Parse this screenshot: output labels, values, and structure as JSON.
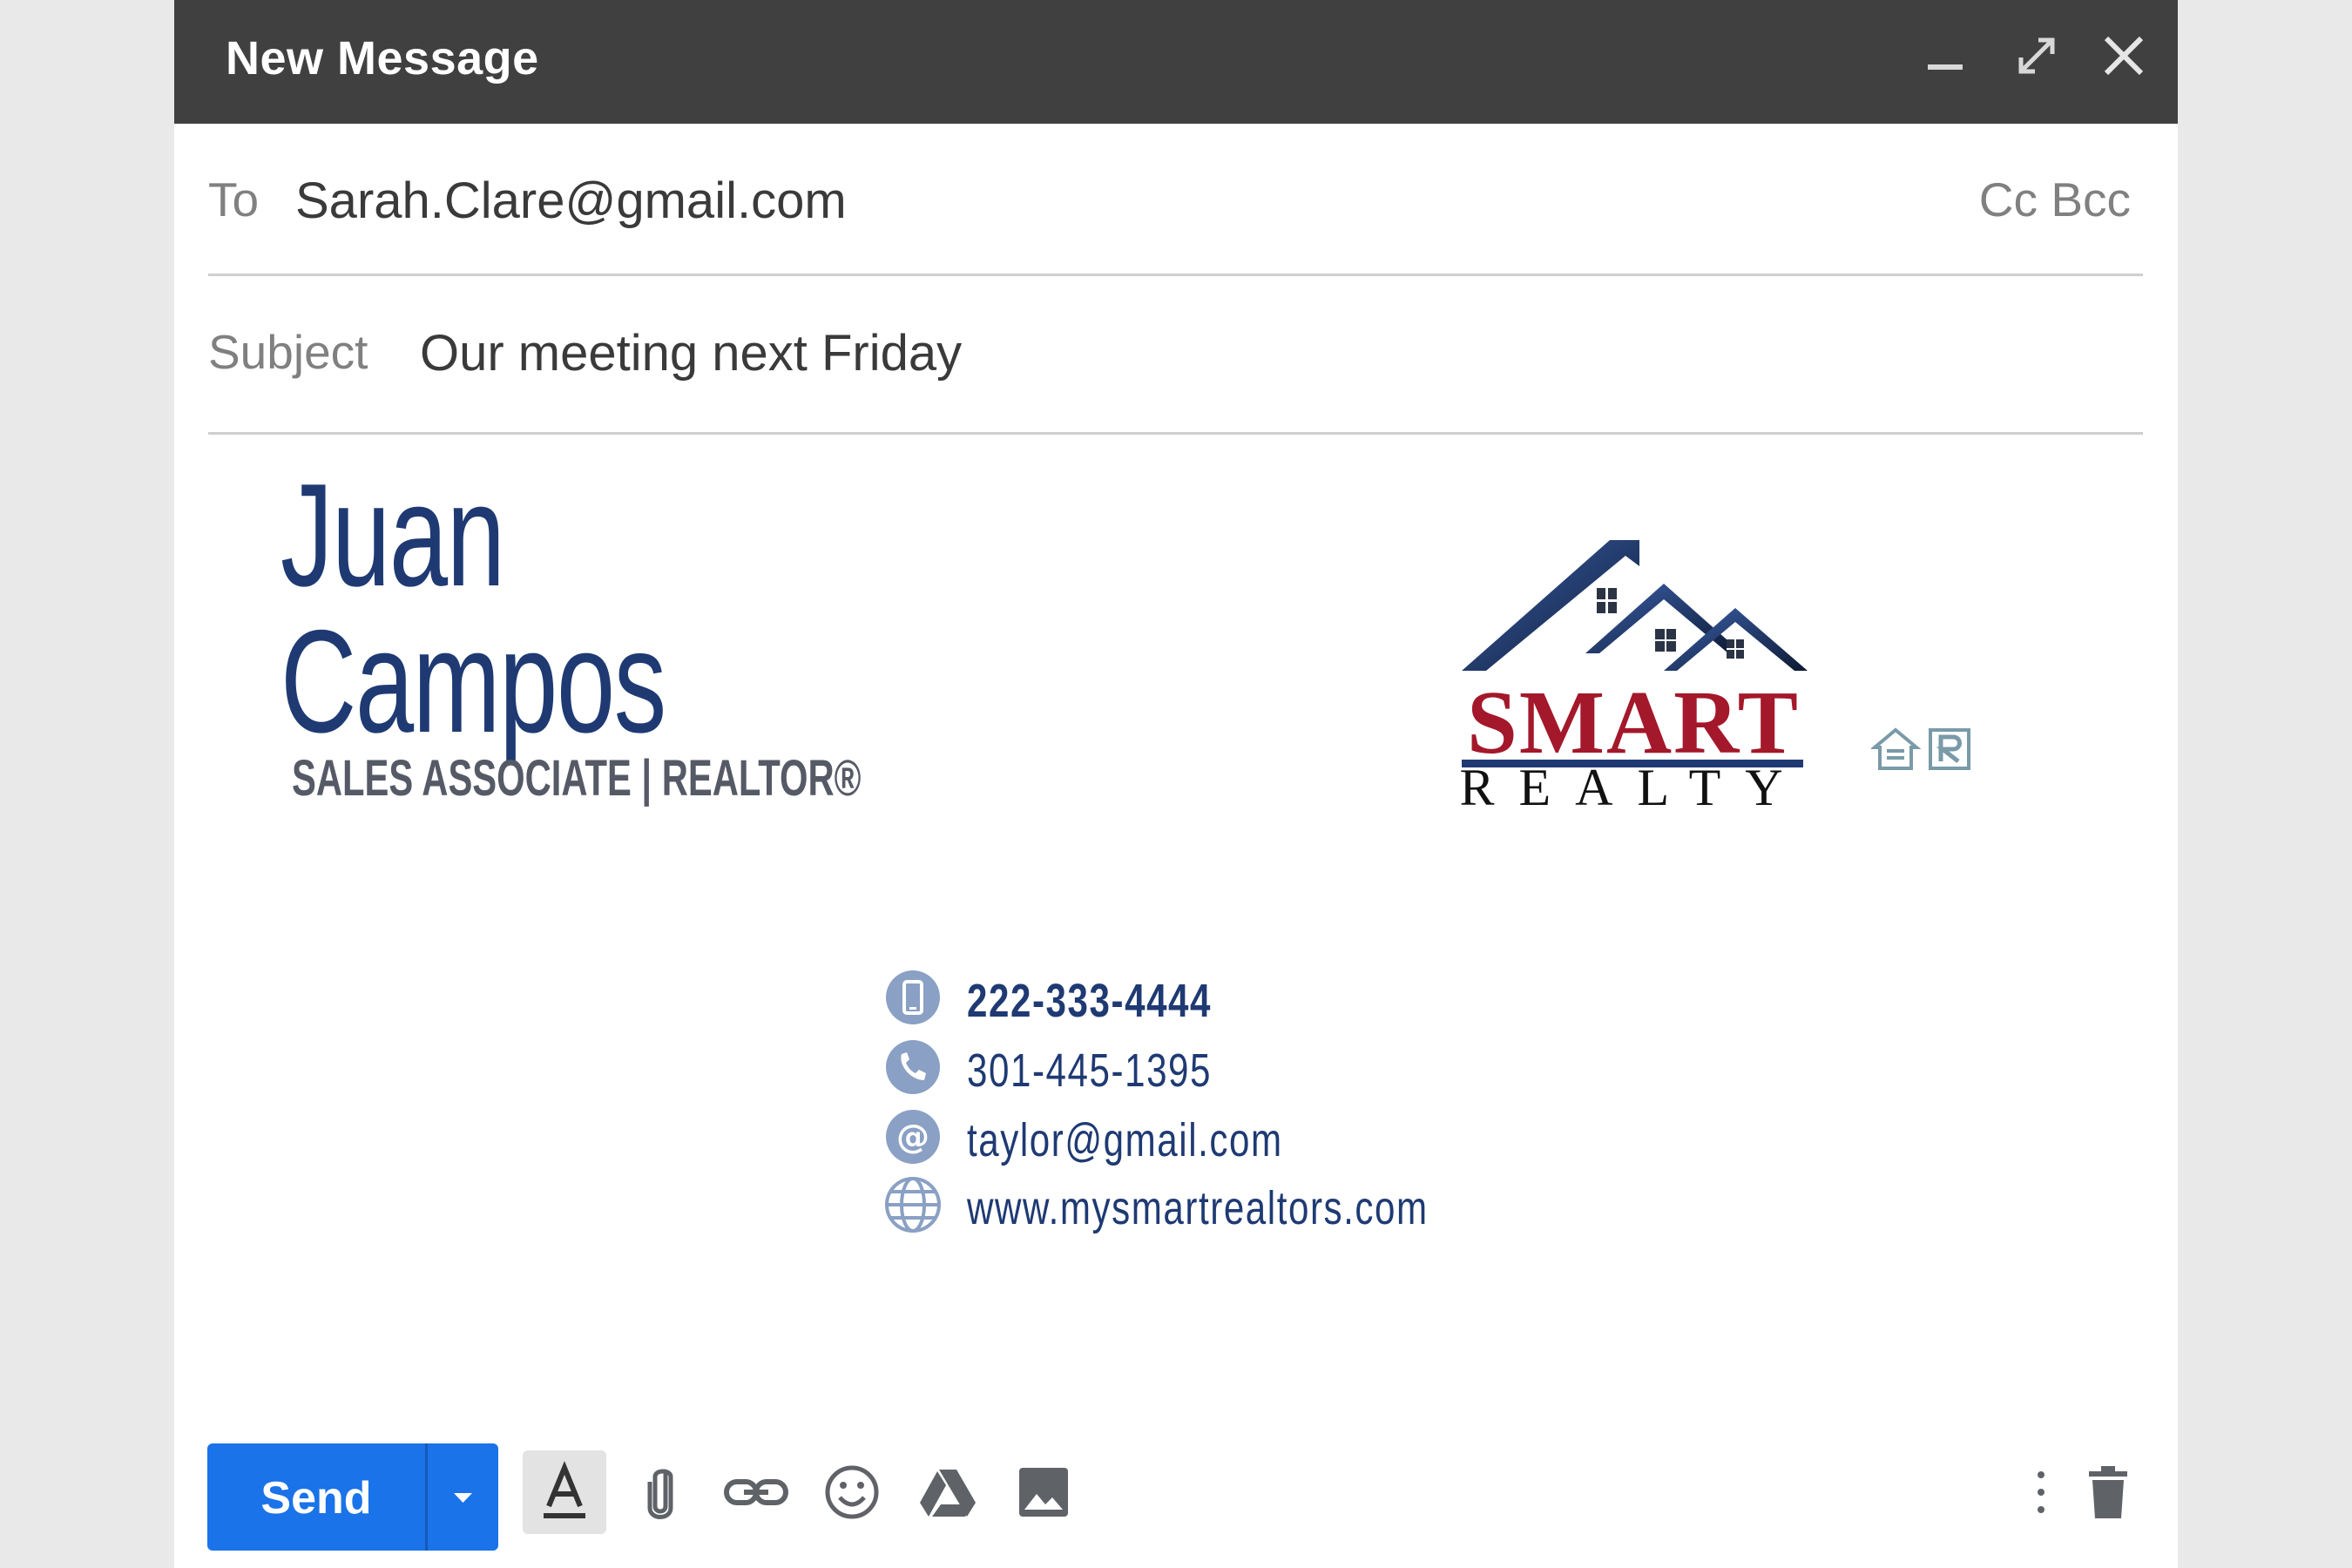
{
  "window": {
    "title": "New Message"
  },
  "to": {
    "label": "To",
    "value": "Sarah.Clare@gmail.com",
    "cc_label": "Cc",
    "bcc_label": "Bcc"
  },
  "subject": {
    "label": "Subject",
    "value": "Our meeting next Friday"
  },
  "signature": {
    "first_name": "Juan",
    "last_name": "Campos",
    "role": "SALES ASSOCIATE | REALTOR®",
    "contacts": [
      {
        "icon": "mobile-phone-icon",
        "text": "222-333-4444"
      },
      {
        "icon": "phone-icon",
        "text": "301-445-1395"
      },
      {
        "icon": "at-sign-icon",
        "text": "taylor@gmail.com"
      },
      {
        "icon": "globe-icon",
        "text": "www.mysmartrealtors.com"
      }
    ],
    "logo": {
      "line1": "SMART",
      "line2": "REALTY"
    },
    "colors": {
      "name": "#1f3a73",
      "logo_red": "#a3182a",
      "icon_blue": "#8aa0c4"
    }
  },
  "toolbar": {
    "send_label": "Send",
    "send_color": "#1a73e8",
    "tools": [
      "formatting-icon",
      "attach-file-icon",
      "insert-link-icon",
      "emoji-icon",
      "google-drive-icon",
      "insert-photo-icon",
      "more-options-icon",
      "discard-draft-icon"
    ]
  }
}
